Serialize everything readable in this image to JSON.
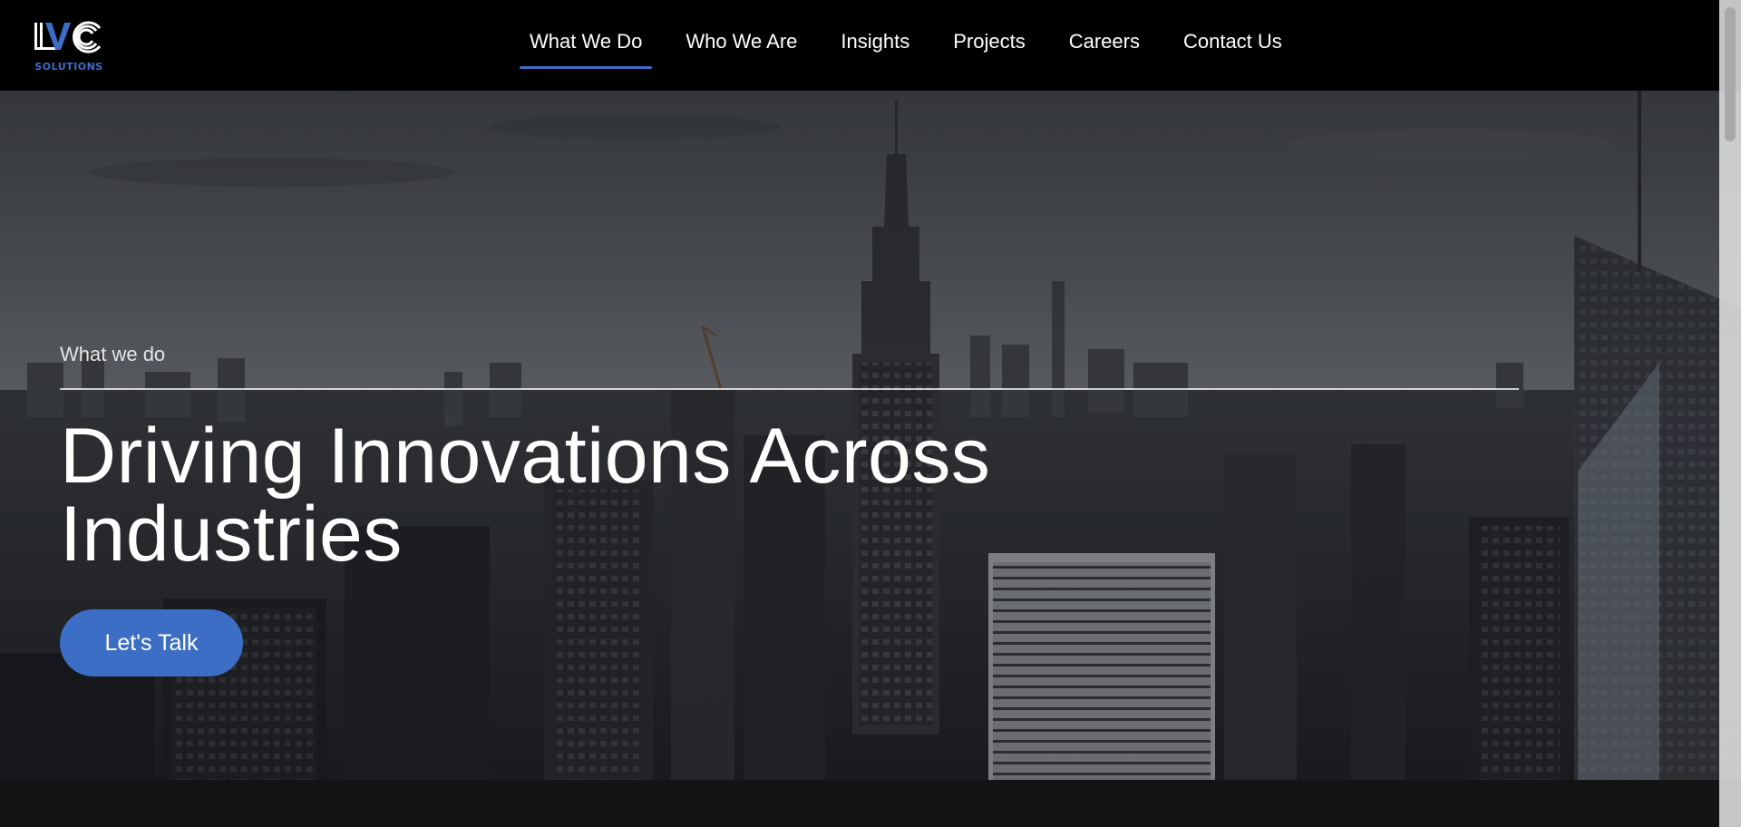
{
  "brand": {
    "logo_text": "SOLUTIONS",
    "accent_color": "#3d6ec6"
  },
  "nav": {
    "items": [
      {
        "label": "What We Do",
        "active": true
      },
      {
        "label": "Who We Are",
        "active": false
      },
      {
        "label": "Insights",
        "active": false
      },
      {
        "label": "Projects",
        "active": false
      },
      {
        "label": "Careers",
        "active": false
      },
      {
        "label": "Contact Us",
        "active": false
      }
    ]
  },
  "hero": {
    "eyebrow": "What we do",
    "headline_line1": "Driving Innovations Across",
    "headline_line2": "Industries",
    "cta_label": "Let's Talk",
    "background": "city-skyline-photo"
  },
  "scrollbar": {
    "position": 0
  }
}
